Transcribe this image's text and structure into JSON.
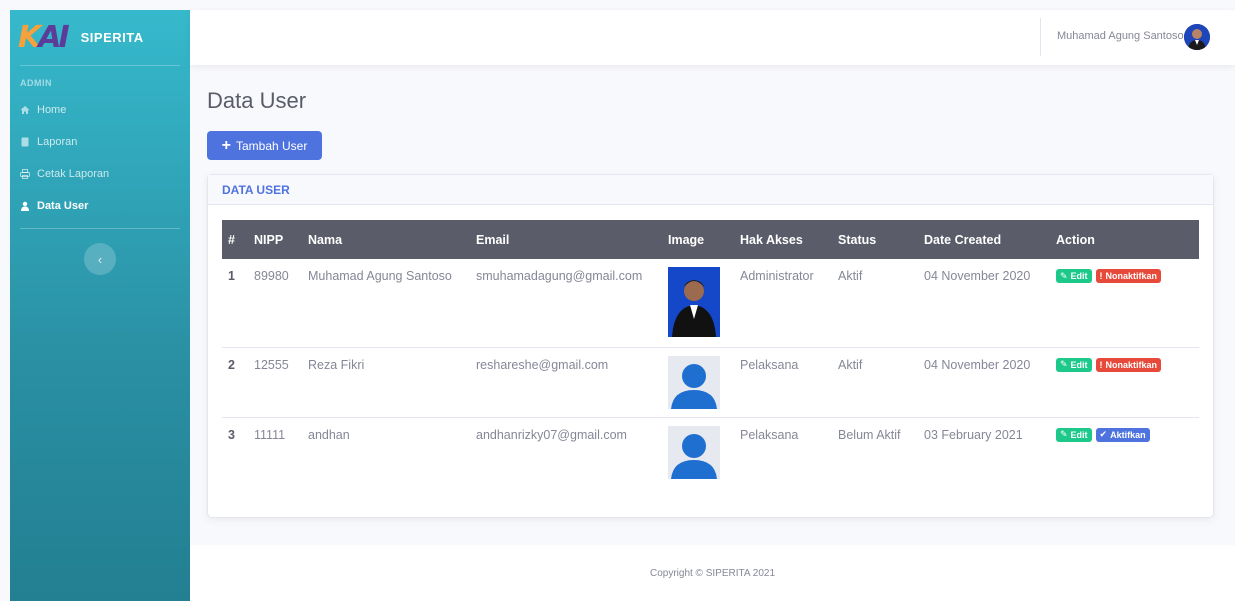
{
  "brand": {
    "logo_text_k": "K",
    "logo_text_ai": "AI",
    "name": "SIPERITA"
  },
  "sidebar": {
    "heading": "ADMIN",
    "items": [
      {
        "label": "Home",
        "icon": "home-icon",
        "active": false
      },
      {
        "label": "Laporan",
        "icon": "document-icon",
        "active": false
      },
      {
        "label": "Cetak Laporan",
        "icon": "print-icon",
        "active": false
      },
      {
        "label": "Data User",
        "icon": "users-icon",
        "active": true
      }
    ],
    "toggle_icon": "chevron-left-icon"
  },
  "topbar": {
    "user_name": "Muhamad Agung Santoso"
  },
  "main": {
    "title": "Data User",
    "add_button": "Tambah User",
    "card_title": "DATA USER",
    "columns": [
      "#",
      "NIPP",
      "Nama",
      "Email",
      "Image",
      "Hak Akses",
      "Status",
      "Date Created",
      "Action"
    ],
    "rows": [
      {
        "no": "1",
        "nipp": "89980",
        "nama": "Muhamad Agung Santoso",
        "email": "smuhamadagung@gmail.com",
        "image": "photo",
        "akses": "Administrator",
        "status": "Aktif",
        "date": "04 November 2020",
        "edit": "Edit",
        "toggle": "Nonaktifkan",
        "toggle_type": "danger"
      },
      {
        "no": "2",
        "nipp": "12555",
        "nama": "Reza Fikri",
        "email": "reshareshe@gmail.com",
        "image": "placeholder",
        "akses": "Pelaksana",
        "status": "Aktif",
        "date": "04 November 2020",
        "edit": "Edit",
        "toggle": "Nonaktifkan",
        "toggle_type": "danger"
      },
      {
        "no": "3",
        "nipp": "11111",
        "nama": "andhan",
        "email": "andhanrizky07@gmail.com",
        "image": "placeholder",
        "akses": "Pelaksana",
        "status": "Belum Aktif",
        "date": "03 February 2021",
        "edit": "Edit",
        "toggle": "Aktifkan",
        "toggle_type": "primary"
      }
    ]
  },
  "footer": {
    "text": "Copyright © SIPERITA 2021"
  },
  "colors": {
    "primary": "#4e73df",
    "success": "#1cc88a",
    "danger": "#e74a3b",
    "sidebar": "#36b9cc",
    "table_header": "#5a5c69"
  }
}
